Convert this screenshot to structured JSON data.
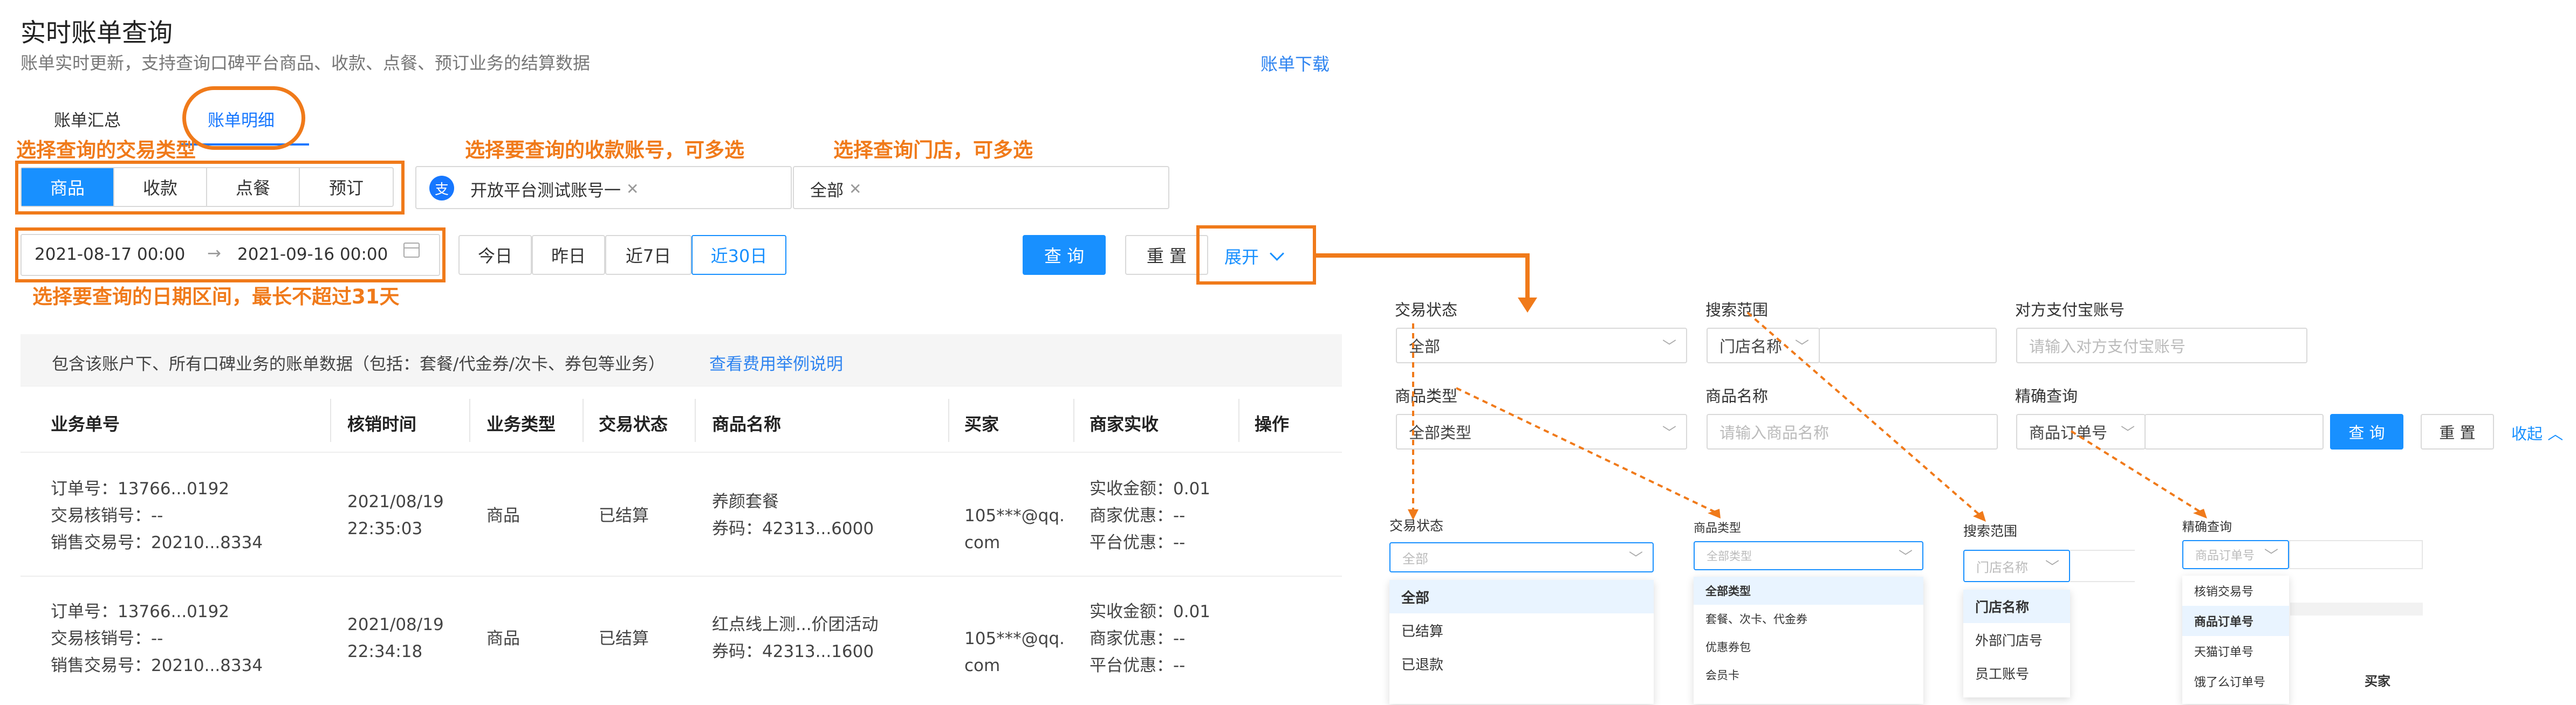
{
  "header": {
    "title": "实时账单查询",
    "subtitle": "账单实时更新，支持查询口碑平台商品、收款、点餐、预订业务的结算数据",
    "download_link": "账单下载"
  },
  "tabs": [
    {
      "label": "账单汇总",
      "active": false
    },
    {
      "label": "账单明细",
      "active": true
    }
  ],
  "annotations": {
    "trade_type": "选择查询的交易类型",
    "account": "选择要查询的收款账号，可多选",
    "store": "选择查询门店，可多选",
    "date_range": "选择要查询的日期区间，最长不超过31天"
  },
  "trade_types": [
    "商品",
    "收款",
    "点餐",
    "预订"
  ],
  "account_select": {
    "icon": "支",
    "tag": "开放平台测试账号一"
  },
  "store_select": {
    "tag": "全部"
  },
  "date_range": {
    "start": "2021-08-17 00:00",
    "arrow": "→",
    "end": "2021-09-16 00:00"
  },
  "quick_dates": [
    "今日",
    "昨日",
    "近7日",
    "近30日"
  ],
  "actions": {
    "query": "查 询",
    "reset": "重 置",
    "expand": "展开"
  },
  "info": {
    "text": "包含该账户下、所有口碑业务的账单数据（包括：套餐/代金券/次卡、券包等业务）",
    "link": "查看费用举例说明"
  },
  "table": {
    "columns": [
      "业务单号",
      "核销时间",
      "业务类型",
      "交易状态",
      "商品名称",
      "买家",
      "商家实收",
      "操作"
    ],
    "rows": [
      {
        "order": [
          "订单号：13766...0192",
          "交易核销号：--",
          "销售交易号：20210...8334"
        ],
        "time": [
          "2021/08/19",
          "22:35:03"
        ],
        "type": "商品",
        "status": "已结算",
        "product": [
          "养颜套餐",
          "券码：42313...6000"
        ],
        "buyer": [
          "105***@qq.",
          "com"
        ],
        "income": [
          "实收金额：0.01",
          "商家优惠：--",
          "平台优惠：--"
        ]
      },
      {
        "order": [
          "订单号：13766...0192",
          "交易核销号：--",
          "销售交易号：20210...8334"
        ],
        "time": [
          "2021/08/19",
          "22:34:18"
        ],
        "type": "商品",
        "status": "已结算",
        "product": [
          "红点线上测...价团活动",
          "券码：42313...1600"
        ],
        "buyer": [
          "105***@qq.",
          "com"
        ],
        "income": [
          "实收金额：0.01",
          "商家优惠：--",
          "平台优惠：--"
        ]
      }
    ]
  },
  "expanded_form": {
    "trade_status_label": "交易状态",
    "trade_status_value": "全部",
    "search_scope_label": "搜索范围",
    "search_scope_value": "门店名称",
    "alipay_label": "对方支付宝账号",
    "alipay_placeholder": "请输入对方支付宝账号",
    "product_type_label": "商品类型",
    "product_type_value": "全部类型",
    "product_name_label": "商品名称",
    "product_name_placeholder": "请输入商品名称",
    "exact_label": "精确查询",
    "exact_value": "商品订单号",
    "query": "查 询",
    "reset": "重 置",
    "collapse": "收起"
  },
  "dropdowns": {
    "trade_status": {
      "label": "交易状态",
      "value": "全部",
      "options": [
        "全部",
        "已结算",
        "已退款"
      ],
      "selected": 0
    },
    "product_type": {
      "label": "商品类型",
      "value": "全部类型",
      "options": [
        "全部类型",
        "套餐、次卡、代金券",
        "优惠券包",
        "会员卡"
      ],
      "selected": 0
    },
    "search_scope": {
      "label": "搜索范围",
      "value": "门店名称",
      "options": [
        "门店名称",
        "外部门店号",
        "员工账号"
      ],
      "selected": 0
    },
    "exact_query": {
      "label": "精确查询",
      "value": "商品订单号",
      "options": [
        "核销交易号",
        "商品订单号",
        "天猫订单号",
        "饿了么订单号"
      ],
      "selected": 1,
      "behind_text": "买家"
    }
  },
  "colors": {
    "accent": "#1890ff",
    "annotation": "#f07a1a"
  }
}
